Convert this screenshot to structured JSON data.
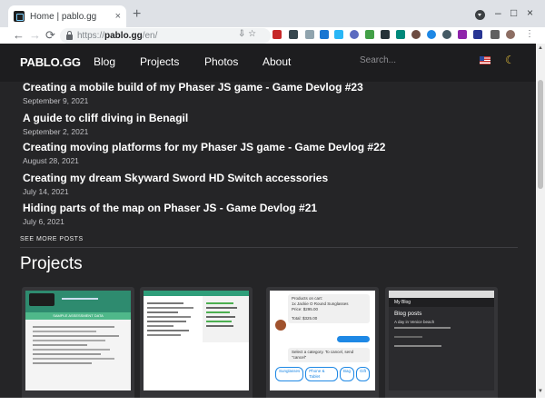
{
  "browser": {
    "tab_title": "Home | pablo.gg",
    "tab_close": "×",
    "new_tab": "+",
    "window_controls": [
      "–",
      "□",
      "×"
    ],
    "back": "←",
    "forward": "→",
    "reload": "⟳",
    "url_scheme": "https://",
    "url_host": "pablo.gg",
    "url_path": "/en/",
    "omnibox_icons": "⇩ ☆"
  },
  "site": {
    "logo": "PABLO.GG",
    "nav": [
      "Blog",
      "Projects",
      "Photos",
      "About"
    ],
    "search_placeholder": "Search...",
    "theme_icon": "☾"
  },
  "posts": [
    {
      "title": "Creating a mobile build of my Phaser JS game - Game Devlog #23",
      "date": "September 9, 2021"
    },
    {
      "title": "A guide to cliff diving in Benagil",
      "date": "September 2, 2021"
    },
    {
      "title": "Creating moving platforms for my Phaser JS game - Game Devlog #22",
      "date": "August 28, 2021"
    },
    {
      "title": "Creating my dream Skyward Sword HD Switch accessories",
      "date": "July 14, 2021"
    },
    {
      "title": "Hiding parts of the map on Phaser JS - Game Devlog #21",
      "date": "July 6, 2021"
    }
  ],
  "see_more": "SEE MORE POSTS",
  "projects_title": "Projects",
  "project_cards": [
    {
      "thumb_title": "SAMPLE ASSESSMENT DATA"
    },
    {
      "thumb_title": ""
    },
    {
      "chat_lines": [
        "Products on cart:",
        "1x Jackie O Round Sunglasses",
        "Price: $295.00",
        "Total: $325.00",
        "Select a category. To cancel, send \"cancel\""
      ],
      "chat_buttons": [
        "Sunglasses",
        "Phone & Tablet",
        "Bag",
        "Gift"
      ]
    },
    {
      "app_title": "My Blog",
      "heading": "Blog posts",
      "item": "A day in Venice beach"
    }
  ],
  "scrollbar": {
    "up": "▲",
    "down": "▼"
  }
}
